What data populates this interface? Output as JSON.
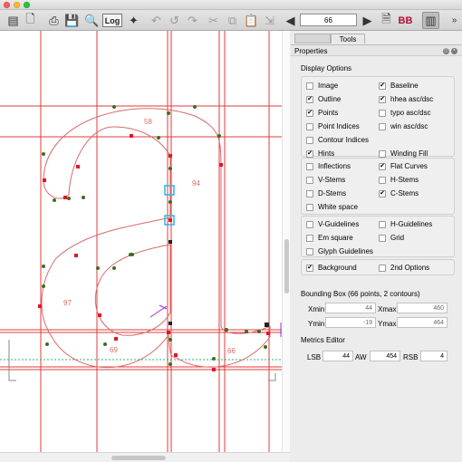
{
  "toolbar": {
    "glyph_number": "66",
    "log_label": "Log",
    "bb_label": "BB",
    "overflow_label": "»"
  },
  "canvas": {
    "glyph_label_58": "58",
    "glyph_label_94": "94",
    "glyph_label_97": "97",
    "glyph_label_69": "69",
    "glyph_label_66": "66"
  },
  "panel": {
    "tabs": [
      "",
      "Tools"
    ],
    "title": "Properties",
    "display_options_label": "Display Options",
    "group1": [
      {
        "label": "Image",
        "checked": false
      },
      {
        "label": "Baseline",
        "checked": true
      },
      {
        "label": "Outline",
        "checked": true
      },
      {
        "label": "hhea asc/dsc",
        "checked": true
      },
      {
        "label": "Points",
        "checked": true
      },
      {
        "label": "typo asc/dsc",
        "checked": false
      },
      {
        "label": "Point Indices",
        "checked": false
      },
      {
        "label": "win asc/dsc",
        "checked": false
      },
      {
        "label": "Contour Indices",
        "checked": false
      },
      {
        "label": "Hints",
        "checked": true
      },
      {
        "label": "Winding Fill",
        "checked": false
      }
    ],
    "group2": [
      {
        "label": "Inflections",
        "checked": false
      },
      {
        "label": "Flat Curves",
        "checked": true
      },
      {
        "label": "V-Stems",
        "checked": false
      },
      {
        "label": "H-Stems",
        "checked": false
      },
      {
        "label": "D-Stems",
        "checked": false
      },
      {
        "label": "C-Stems",
        "checked": true
      },
      {
        "label": "White space",
        "checked": false
      }
    ],
    "group3": [
      {
        "label": "V-Guidelines",
        "checked": false
      },
      {
        "label": "H-Guidelines",
        "checked": false
      },
      {
        "label": "Em square",
        "checked": false
      },
      {
        "label": "Grid",
        "checked": false
      },
      {
        "label": "Glyph Guidelines",
        "checked": false
      }
    ],
    "group4": [
      {
        "label": "Background",
        "checked": true
      },
      {
        "label": "2nd Options",
        "checked": false
      }
    ],
    "bounding_box_label": "Bounding Box (66 points, 2 contours)",
    "bbox": {
      "xmin_label": "Xmin",
      "xmin": "44",
      "xmax_label": "Xmax",
      "xmax": "460",
      "ymin_label": "Ymin",
      "ymin": "-19",
      "ymax_label": "Ymax",
      "ymax": "464"
    },
    "metrics_label": "Metrics Editor",
    "metrics": {
      "lsb_label": "LSB",
      "lsb": "44",
      "aw_label": "AW",
      "aw": "454",
      "rsb_label": "RSB",
      "rsb": "4"
    }
  },
  "colors": {
    "guide_red": "#e23b3b",
    "outline": "#d96a6a",
    "on_curve": "#e0182a",
    "off_curve": "#3a6e1e",
    "selection": "#29b6e6",
    "baseline_green": "#35b070"
  }
}
